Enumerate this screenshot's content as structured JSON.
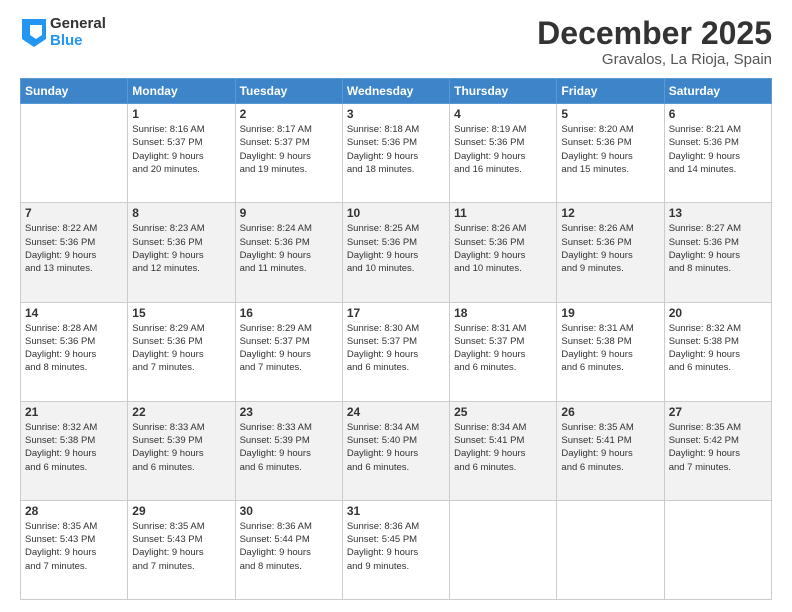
{
  "logo": {
    "general": "General",
    "blue": "Blue"
  },
  "header": {
    "month": "December 2025",
    "location": "Gravalos, La Rioja, Spain"
  },
  "weekdays": [
    "Sunday",
    "Monday",
    "Tuesday",
    "Wednesday",
    "Thursday",
    "Friday",
    "Saturday"
  ],
  "weeks": [
    [
      {
        "day": "",
        "info": ""
      },
      {
        "day": "1",
        "info": "Sunrise: 8:16 AM\nSunset: 5:37 PM\nDaylight: 9 hours\nand 20 minutes."
      },
      {
        "day": "2",
        "info": "Sunrise: 8:17 AM\nSunset: 5:37 PM\nDaylight: 9 hours\nand 19 minutes."
      },
      {
        "day": "3",
        "info": "Sunrise: 8:18 AM\nSunset: 5:36 PM\nDaylight: 9 hours\nand 18 minutes."
      },
      {
        "day": "4",
        "info": "Sunrise: 8:19 AM\nSunset: 5:36 PM\nDaylight: 9 hours\nand 16 minutes."
      },
      {
        "day": "5",
        "info": "Sunrise: 8:20 AM\nSunset: 5:36 PM\nDaylight: 9 hours\nand 15 minutes."
      },
      {
        "day": "6",
        "info": "Sunrise: 8:21 AM\nSunset: 5:36 PM\nDaylight: 9 hours\nand 14 minutes."
      }
    ],
    [
      {
        "day": "7",
        "info": "Sunrise: 8:22 AM\nSunset: 5:36 PM\nDaylight: 9 hours\nand 13 minutes."
      },
      {
        "day": "8",
        "info": "Sunrise: 8:23 AM\nSunset: 5:36 PM\nDaylight: 9 hours\nand 12 minutes."
      },
      {
        "day": "9",
        "info": "Sunrise: 8:24 AM\nSunset: 5:36 PM\nDaylight: 9 hours\nand 11 minutes."
      },
      {
        "day": "10",
        "info": "Sunrise: 8:25 AM\nSunset: 5:36 PM\nDaylight: 9 hours\nand 10 minutes."
      },
      {
        "day": "11",
        "info": "Sunrise: 8:26 AM\nSunset: 5:36 PM\nDaylight: 9 hours\nand 10 minutes."
      },
      {
        "day": "12",
        "info": "Sunrise: 8:26 AM\nSunset: 5:36 PM\nDaylight: 9 hours\nand 9 minutes."
      },
      {
        "day": "13",
        "info": "Sunrise: 8:27 AM\nSunset: 5:36 PM\nDaylight: 9 hours\nand 8 minutes."
      }
    ],
    [
      {
        "day": "14",
        "info": "Sunrise: 8:28 AM\nSunset: 5:36 PM\nDaylight: 9 hours\nand 8 minutes."
      },
      {
        "day": "15",
        "info": "Sunrise: 8:29 AM\nSunset: 5:36 PM\nDaylight: 9 hours\nand 7 minutes."
      },
      {
        "day": "16",
        "info": "Sunrise: 8:29 AM\nSunset: 5:37 PM\nDaylight: 9 hours\nand 7 minutes."
      },
      {
        "day": "17",
        "info": "Sunrise: 8:30 AM\nSunset: 5:37 PM\nDaylight: 9 hours\nand 6 minutes."
      },
      {
        "day": "18",
        "info": "Sunrise: 8:31 AM\nSunset: 5:37 PM\nDaylight: 9 hours\nand 6 minutes."
      },
      {
        "day": "19",
        "info": "Sunrise: 8:31 AM\nSunset: 5:38 PM\nDaylight: 9 hours\nand 6 minutes."
      },
      {
        "day": "20",
        "info": "Sunrise: 8:32 AM\nSunset: 5:38 PM\nDaylight: 9 hours\nand 6 minutes."
      }
    ],
    [
      {
        "day": "21",
        "info": "Sunrise: 8:32 AM\nSunset: 5:38 PM\nDaylight: 9 hours\nand 6 minutes."
      },
      {
        "day": "22",
        "info": "Sunrise: 8:33 AM\nSunset: 5:39 PM\nDaylight: 9 hours\nand 6 minutes."
      },
      {
        "day": "23",
        "info": "Sunrise: 8:33 AM\nSunset: 5:39 PM\nDaylight: 9 hours\nand 6 minutes."
      },
      {
        "day": "24",
        "info": "Sunrise: 8:34 AM\nSunset: 5:40 PM\nDaylight: 9 hours\nand 6 minutes."
      },
      {
        "day": "25",
        "info": "Sunrise: 8:34 AM\nSunset: 5:41 PM\nDaylight: 9 hours\nand 6 minutes."
      },
      {
        "day": "26",
        "info": "Sunrise: 8:35 AM\nSunset: 5:41 PM\nDaylight: 9 hours\nand 6 minutes."
      },
      {
        "day": "27",
        "info": "Sunrise: 8:35 AM\nSunset: 5:42 PM\nDaylight: 9 hours\nand 7 minutes."
      }
    ],
    [
      {
        "day": "28",
        "info": "Sunrise: 8:35 AM\nSunset: 5:43 PM\nDaylight: 9 hours\nand 7 minutes."
      },
      {
        "day": "29",
        "info": "Sunrise: 8:35 AM\nSunset: 5:43 PM\nDaylight: 9 hours\nand 7 minutes."
      },
      {
        "day": "30",
        "info": "Sunrise: 8:36 AM\nSunset: 5:44 PM\nDaylight: 9 hours\nand 8 minutes."
      },
      {
        "day": "31",
        "info": "Sunrise: 8:36 AM\nSunset: 5:45 PM\nDaylight: 9 hours\nand 9 minutes."
      },
      {
        "day": "",
        "info": ""
      },
      {
        "day": "",
        "info": ""
      },
      {
        "day": "",
        "info": ""
      }
    ]
  ]
}
